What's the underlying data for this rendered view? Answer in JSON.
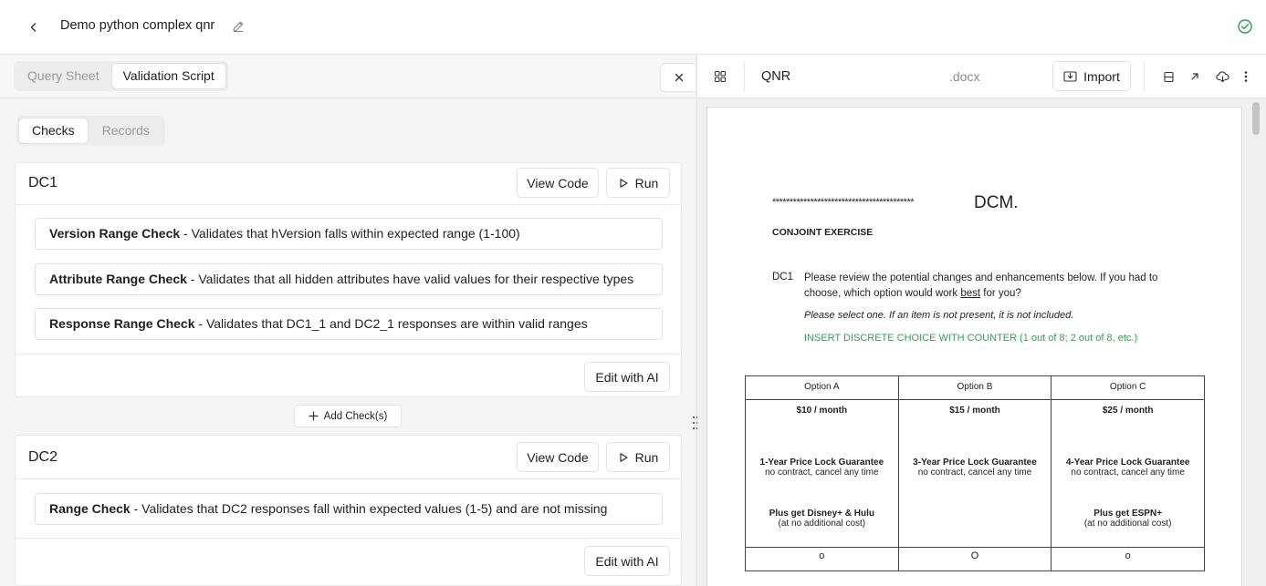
{
  "header": {
    "title": "Demo python complex qnr"
  },
  "left_tabs": [
    "Query Sheet",
    "Validation Script"
  ],
  "left_tabs_active": 1,
  "sub_tabs": [
    "Checks",
    "Records"
  ],
  "sub_tabs_active": 0,
  "buttons": {
    "view_code": "View Code",
    "run": "Run",
    "edit_ai": "Edit with AI",
    "add_checks": "Add Check(s)"
  },
  "cards": [
    {
      "title": "DC1",
      "checks": [
        {
          "name": "Version Range Check",
          "desc": "Validates that hVersion falls within expected range (1-100)"
        },
        {
          "name": "Attribute Range Check",
          "desc": "Validates that all hidden attributes have valid values for their respective types"
        },
        {
          "name": "Response Range Check",
          "desc": "Validates that DC1_1 and DC2_1 responses are within valid ranges"
        }
      ]
    },
    {
      "title": "DC2",
      "checks": [
        {
          "name": "Range Check",
          "desc": "Validates that DC2 responses fall within expected values (1-5) and are not missing"
        }
      ]
    }
  ],
  "right": {
    "doc_name": "QNR",
    "doc_ext": ".docx",
    "import_label": "Import"
  },
  "document": {
    "stars": "*****************************************",
    "dcm": "DCM.",
    "section": "CONJOINT EXERCISE",
    "qnum": "DC1",
    "question_pre": "Please review the potential changes and enhancements below. If you had to choose, which option would work ",
    "question_underlined": "best",
    "question_post": " for you?",
    "instruction": "Please select one. If an item is not present, it is not included.",
    "insert": "INSERT DISCRETE CHOICE WITH COUNTER (1 out of 8; 2 out of 8, etc.)",
    "options": [
      {
        "label": "Option A",
        "price": "$10 / month",
        "lock": "1-Year Price Lock Guarantee",
        "terms": "no contract, cancel any time",
        "plus": "Plus get Disney+ & Hulu",
        "extra": "(at no additional cost)",
        "radio": "o"
      },
      {
        "label": "Option B",
        "price": "$15 / month",
        "lock": "3-Year Price Lock Guarantee",
        "terms": "no contract, cancel any time",
        "plus": "",
        "extra": "",
        "radio": "O"
      },
      {
        "label": "Option C",
        "price": "$25 / month",
        "lock": "4-Year Price Lock Guarantee",
        "terms": "no contract, cancel any time",
        "plus": "Plus get ESPN+",
        "extra": "(at no additional cost)",
        "radio": "o"
      }
    ]
  },
  "colors": {
    "accent_green": "#2ea44f",
    "border": "#e2e2e2",
    "muted_text": "#9a9a9a"
  }
}
